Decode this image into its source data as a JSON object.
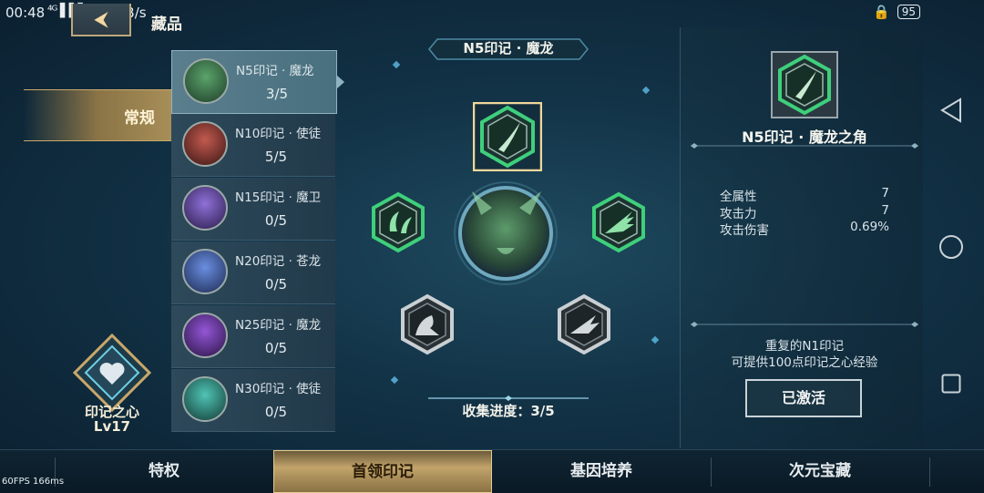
{
  "status_bar": {
    "time": "00:48",
    "signal": "⁴ᴳ ▌▌▌",
    "speed": "772 B/s",
    "battery": "95"
  },
  "header": {
    "title": "藏品"
  },
  "category_tab": {
    "label": "常规"
  },
  "boss_list": [
    {
      "name": "N5印记 · 魔龙",
      "count": "3/5",
      "active": true,
      "color": "#3f7a4c"
    },
    {
      "name": "N10印记 · 使徒",
      "count": "5/5",
      "active": false,
      "color": "#9c3a34"
    },
    {
      "name": "N15印记 · 魔卫",
      "count": "0/5",
      "active": false,
      "color": "#6a4bb0"
    },
    {
      "name": "N20印记 · 苍龙",
      "count": "0/5",
      "active": false,
      "color": "#3f64b8"
    },
    {
      "name": "N25印记 · 魔龙",
      "count": "0/5",
      "active": false,
      "color": "#6a34a8"
    },
    {
      "name": "N30印记 · 使徒",
      "count": "0/5",
      "active": false,
      "color": "#2d8c80"
    }
  ],
  "heart": {
    "name": "印记之心",
    "level": "Lv17"
  },
  "center": {
    "title": "N5印记 · 魔龙",
    "progress": "收集进度：3/5"
  },
  "detail": {
    "name": "N5印记 · 魔龙之角",
    "stats": [
      {
        "label": "全属性",
        "value": "7"
      },
      {
        "label": "攻击力",
        "value": "7"
      },
      {
        "label": "攻击伤害",
        "value": "0.69%"
      }
    ],
    "desc_line1": "重复的N1印记",
    "desc_line2": "可提供100点印记之心经验",
    "button": "已激活"
  },
  "bottom_tabs": [
    {
      "label": "特权",
      "active": false
    },
    {
      "label": "首领印记",
      "active": true
    },
    {
      "label": "基因培养",
      "active": false
    },
    {
      "label": "次元宝藏",
      "active": false
    }
  ],
  "debug": {
    "fps": "60FPS   166ms"
  },
  "colors": {
    "accent_gold": "#c2a46b",
    "emblem_green": "#2fb36a",
    "bg": "#123246"
  }
}
